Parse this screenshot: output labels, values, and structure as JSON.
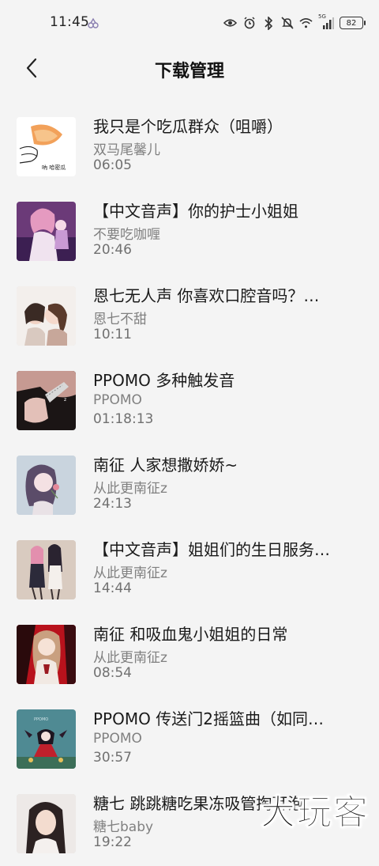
{
  "status_bar": {
    "time": "11:45",
    "network_label": "5G",
    "battery": "82"
  },
  "header": {
    "title": "下载管理"
  },
  "downloads": [
    {
      "title": "我只是个吃瓜群众（咀嚼）",
      "author": "双马尾馨儿",
      "duration": "06:05",
      "thumb_text": "吶 哈密瓜"
    },
    {
      "title": "【中文音声】你的护士小姐姐",
      "author": "不要吃咖喱",
      "duration": "20:46"
    },
    {
      "title": "恩七无人声 你喜欢口腔音吗？…",
      "author": "恩七不甜",
      "duration": "10:11"
    },
    {
      "title": "PPOMO 多种触发音",
      "author": "PPOMO",
      "duration": "01:18:13"
    },
    {
      "title": "南征 人家想撒娇娇~",
      "author": "从此更南征z",
      "duration": "24:13"
    },
    {
      "title": "【中文音声】姐姐们的生日服务…",
      "author": "从此更南征z",
      "duration": "14:44"
    },
    {
      "title": "南征 和吸血鬼小姐姐的日常",
      "author": "从此更南征z",
      "duration": "08:54"
    },
    {
      "title": "PPOMO 传送门2摇篮曲（如同…",
      "author": "PPOMO",
      "duration": "30:57"
    },
    {
      "title": "糖七 跳跳糖吃果冻吸管掏耳泡…",
      "author": "糖七baby",
      "duration": "19:22"
    }
  ],
  "watermark": "大玩客"
}
